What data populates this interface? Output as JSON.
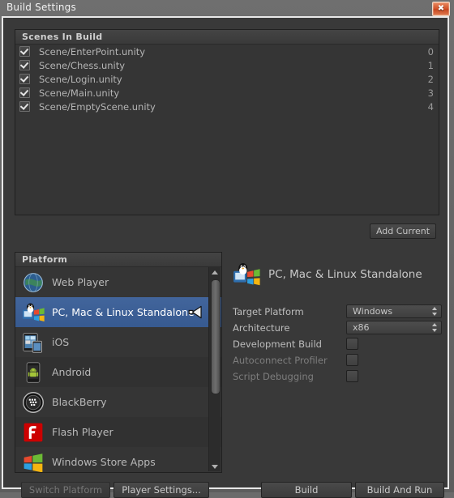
{
  "window": {
    "title": "Build Settings",
    "close_icon": "close-icon",
    "close_glyph": "✖"
  },
  "scenes_panel": {
    "header": "Scenes In Build",
    "add_current_label": "Add Current",
    "scenes": [
      {
        "name": "Scene/EnterPoint.unity",
        "index": "0",
        "checked": true
      },
      {
        "name": "Scene/Chess.unity",
        "index": "1",
        "checked": true
      },
      {
        "name": "Scene/Login.unity",
        "index": "2",
        "checked": true
      },
      {
        "name": "Scene/Main.unity",
        "index": "3",
        "checked": true
      },
      {
        "name": "Scene/EmptyScene.unity",
        "index": "4",
        "checked": true
      }
    ]
  },
  "platform_panel": {
    "header": "Platform",
    "items": [
      {
        "label": "Web Player",
        "icon": "globe-icon",
        "selected": false
      },
      {
        "label": "PC, Mac & Linux Standalone",
        "icon": "desktop-os-icon",
        "selected": true
      },
      {
        "label": "iOS",
        "icon": "ipad-iphone-icon",
        "selected": false
      },
      {
        "label": "Android",
        "icon": "android-phone-icon",
        "selected": false
      },
      {
        "label": "BlackBerry",
        "icon": "blackberry-icon",
        "selected": false
      },
      {
        "label": "Flash Player",
        "icon": "flash-icon",
        "selected": false
      },
      {
        "label": "Windows Store Apps",
        "icon": "windows-flag-icon",
        "selected": false
      }
    ],
    "active_marker_icon": "unity-logo-icon",
    "scrollbar": {
      "up_icon": "scroll-up-arrow-icon",
      "down_icon": "scroll-down-arrow-icon"
    }
  },
  "settings_panel": {
    "title": "PC, Mac & Linux Standalone",
    "title_icon": "desktop-os-icon",
    "target_platform": {
      "label": "Target Platform",
      "value": "Windows",
      "enabled": true
    },
    "architecture": {
      "label": "Architecture",
      "value": "x86",
      "enabled": true
    },
    "development_build": {
      "label": "Development Build",
      "checked": false,
      "enabled": true
    },
    "autoconnect_profiler": {
      "label": "Autoconnect Profiler",
      "checked": false,
      "enabled": false
    },
    "script_debugging": {
      "label": "Script Debugging",
      "checked": false,
      "enabled": false
    }
  },
  "footer": {
    "switch_platform": "Switch Platform",
    "player_settings": "Player Settings...",
    "build": "Build",
    "build_and_run": "Build And Run"
  },
  "colors": {
    "selection_blue": "#3a5f94",
    "panel_bg": "#353535",
    "window_bg": "#393939",
    "close_red": "#d2542a"
  }
}
